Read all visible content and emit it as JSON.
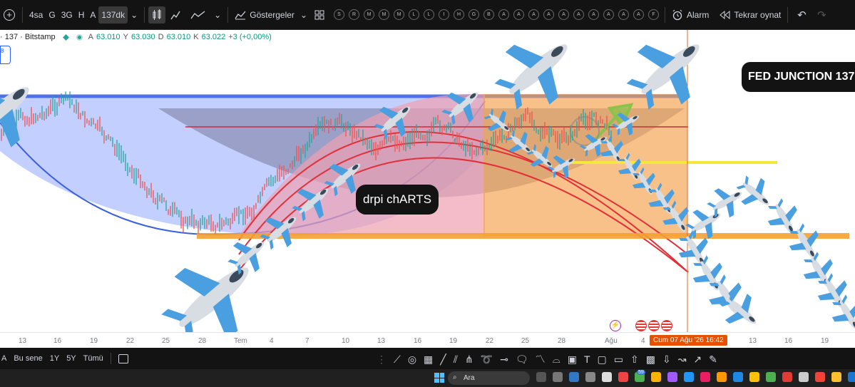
{
  "toolbar": {
    "intervals": [
      "4sa",
      "G",
      "3G",
      "H",
      "A"
    ],
    "active_interval": "137dk",
    "indicators_label": "Göstergeler",
    "favorites": [
      "S",
      "R",
      "M",
      "M",
      "M",
      "L",
      "L",
      "I",
      "H",
      "G",
      "B",
      "A",
      "A",
      "A",
      "A",
      "A",
      "A",
      "A",
      "A",
      "A",
      "A",
      "F"
    ],
    "alarm_label": "Alarm",
    "replay_label": "Tekrar oynat"
  },
  "legend": {
    "symbol": "· 137 · Bitstamp",
    "a_label": "A",
    "a_value": "63.010",
    "y_label": "Y",
    "y_value": "63.030",
    "d_label": "D",
    "d_value": "63.010",
    "k_label": "K",
    "k_value": "63.022",
    "change": "+3 (+0,00%)"
  },
  "left_badge": "8",
  "labels": {
    "watermark": "drpi chARTS",
    "fed": "FED JUNCTION 137"
  },
  "time_axis": [
    "13",
    "16",
    "19",
    "22",
    "25",
    "28",
    "Tem",
    "4",
    "7",
    "10",
    "13",
    "16",
    "19",
    "22",
    "25",
    "28",
    "Ağu",
    "4",
    "13",
    "16",
    "19"
  ],
  "time_label": "Cum 07 Ağu '26  16:42",
  "bottom": {
    "range_a": "A",
    "range_this_year": "Bu sene",
    "range_1y": "1Y",
    "range_5y": "5Y",
    "range_all": "Tümü"
  },
  "taskbar": {
    "search_placeholder": "Ara",
    "badge_count": "59"
  },
  "colors": {
    "blue_zone": "#8fa8ff",
    "orange_zone": "#f5a04a",
    "pink_zone": "#f0a0b0",
    "red_line": "#e0303a",
    "yellow_line": "#f5e83a",
    "blue_line": "#3a5fe0"
  }
}
